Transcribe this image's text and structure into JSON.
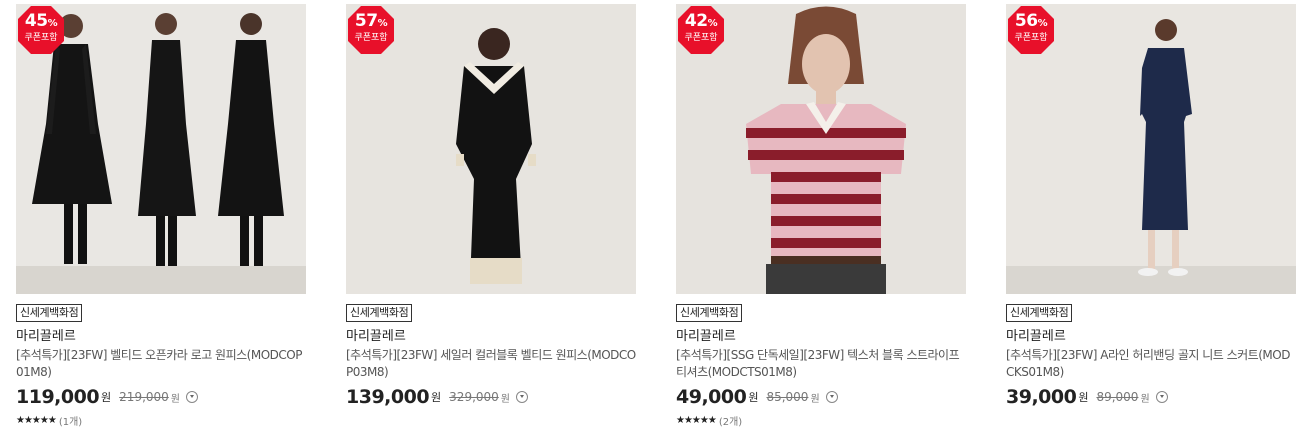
{
  "products": [
    {
      "discount": "45",
      "discount_unit": "%",
      "coupon": "쿠폰포함",
      "store": "신세계백화점",
      "brand": "마리끌레르",
      "title": "[추석특가][23FW] 벨티드 오픈카라 로고 원피스(MODCOP01M8)",
      "price": "119,000",
      "price_unit": "원",
      "original_price": "219,000",
      "original_unit": "원",
      "stars": "★★★★★",
      "review_count": "(1개)"
    },
    {
      "discount": "57",
      "discount_unit": "%",
      "coupon": "쿠폰포함",
      "store": "신세계백화점",
      "brand": "마리끌레르",
      "title": "[추석특가][23FW] 세일러 컬러블록 벨티드 원피스(MODCOP03M8)",
      "price": "139,000",
      "price_unit": "원",
      "original_price": "329,000",
      "original_unit": "원",
      "stars": "",
      "review_count": ""
    },
    {
      "discount": "42",
      "discount_unit": "%",
      "coupon": "쿠폰포함",
      "store": "신세계백화점",
      "brand": "마리끌레르",
      "title": "[추석특가][SSG 단독세일][23FW] 텍스처 블록 스트라이프 티셔츠(MODCTS01M8)",
      "price": "49,000",
      "price_unit": "원",
      "original_price": "85,000",
      "original_unit": "원",
      "stars": "★★★★★",
      "review_count": "(2개)"
    },
    {
      "discount": "56",
      "discount_unit": "%",
      "coupon": "쿠폰포함",
      "store": "신세계백화점",
      "brand": "마리끌레르",
      "title": "[추석특가][23FW] A라인 허리밴딩 골지 니트 스커트(MODCKS01M8)",
      "price": "39,000",
      "price_unit": "원",
      "original_price": "89,000",
      "original_unit": "원",
      "stars": "",
      "review_count": ""
    }
  ],
  "colors": {
    "badge": "#e8102a",
    "price": "#222222",
    "original_price": "#777777"
  },
  "icons": {
    "badge": "octagon-badge",
    "info": "chevron-down-circle-icon",
    "star": "star-icon"
  }
}
